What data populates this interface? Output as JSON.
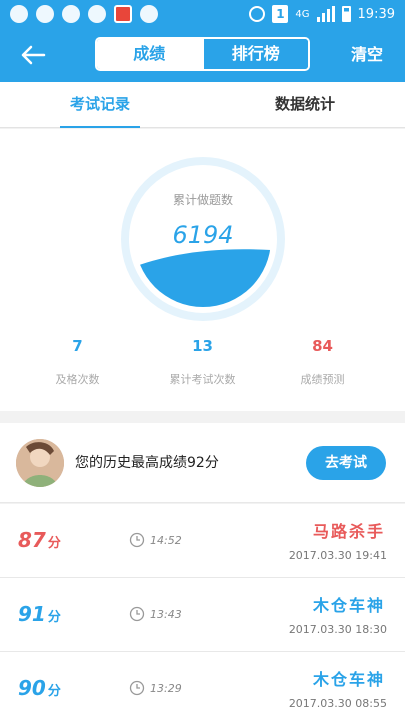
{
  "statusbar": {
    "network": "4G",
    "sim": "1",
    "time": "19:39"
  },
  "header": {
    "back_icon": "back-arrow-icon",
    "tab_scores": "成绩",
    "tab_rank": "排行榜",
    "clear": "清空"
  },
  "tabs": {
    "exam_records": "考试记录",
    "data_stats": "数据统计"
  },
  "stats": {
    "gauge_label": "累计做题数",
    "gauge_value": "6194",
    "pass_count": "7",
    "pass_label": "及格次数",
    "exam_count": "13",
    "exam_label": "累计考试次数",
    "forecast": "84",
    "forecast_label": "成绩预测"
  },
  "best": {
    "text": "您的历史最高成绩92分",
    "button": "去考试"
  },
  "records": [
    {
      "score": "87",
      "unit": "分",
      "duration": "14:52",
      "title": "马路杀手",
      "datetime": "2017.03.30   19:41",
      "color": "#e85a5a"
    },
    {
      "score": "91",
      "unit": "分",
      "duration": "13:43",
      "title": "木仓车神",
      "datetime": "2017.03.30   18:30",
      "color": "#2aa3e8"
    },
    {
      "score": "90",
      "unit": "分",
      "duration": "13:29",
      "title": "木仓车神",
      "datetime": "2017.03.30   08:55",
      "color": "#2aa3e8"
    }
  ],
  "colors": {
    "accent": "#2aa3e8",
    "warning": "#e85a5a"
  }
}
